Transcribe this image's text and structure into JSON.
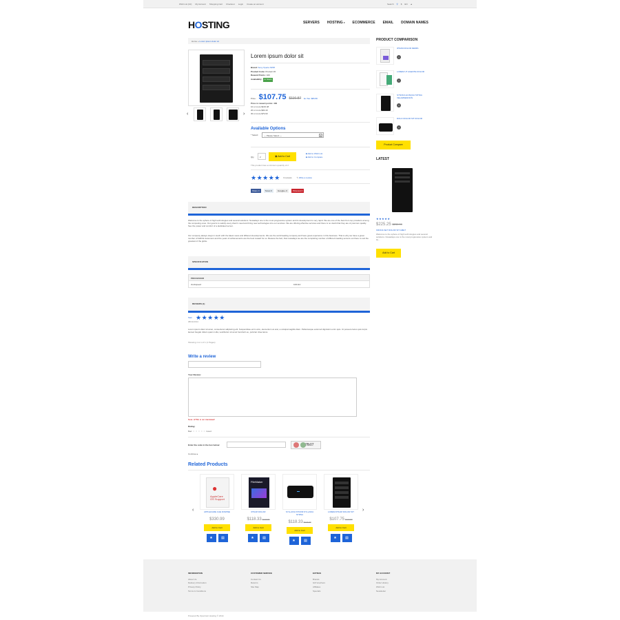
{
  "topbar": {
    "links": [
      "Wish List (10)",
      "My Account",
      "Shopping Cart",
      "Checkout",
      "Login",
      "Create an account"
    ],
    "search_label": "Search",
    "currency": "$",
    "language": "EN"
  },
  "header": {
    "logo_pre": "H",
    "logo_o": "O",
    "logo_post": "STING",
    "nav": [
      "SERVERS",
      "HOSTING",
      "ECOMMERCE",
      "EMAIL",
      "DOMAIN NAMES"
    ]
  },
  "breadcrumb": {
    "home": "Home",
    "sep": "»",
    "current": "Lorem ipsum dolor sit"
  },
  "product": {
    "title": "Lorem ipsum dolor sit",
    "brand_label": "Brand:",
    "brand": "Sony Xperia SP25",
    "code_label": "Product Code:",
    "code": "Product 15",
    "points_label": "Reward Points:",
    "points": "100",
    "avail_label": "Availability:",
    "avail": "In Stock",
    "price_label": "Price:",
    "price": "$107.75",
    "old_price": "$116.87",
    "tax": "Ex Tax: $89.80",
    "reward_note": "Price in reward points: 400",
    "discounts": [
      "10 or more $106.48",
      "20 or more $93.40",
      "30 or more $79.90"
    ],
    "options_head": "Available Options",
    "select_label": "* Select:",
    "select_value": " --- Please Select --- ",
    "qty_label": "Qty",
    "qty_value": "2",
    "add_to_cart": "Add to Cart",
    "wishlist": "Add to Wish List",
    "compare": "Add to Compare",
    "min_qty": "This product has a minimum quantity of 2",
    "reviews_count": "3 reviews",
    "write_review": "Write a review",
    "social": [
      "Share 0",
      "Tweet 0",
      "Google+ 0",
      "Pinterest 0"
    ]
  },
  "tabs": {
    "description": "DESCRIPTION",
    "desc_p1": "Welcome to the sphere of high technologies and several solutions. Nowadays one is the most progressive system and its development is very rapid. We are one of the best from top providers among the competing ones. Our goal is to satisfy every client's need and bring new technologies into our services. We are offering effective services and there is no doubt that they are of premium quality. See the power and comfort of a dedicated server.",
    "desc_p2": "Our company always stays in touch with the latest news and different developments. We are the world leading company and have great experience in this business. That is why we have a great number of faithful customers and the years of achievements are the best reward for us. Beware the fact, that nowadays we are the completing number of different leading servers out there to suit the greatest of the globe.",
    "specification": "SPECIFICATION",
    "spec_group": "PROCESSOR",
    "spec_key": "clockspeed",
    "spec_val": "100mhz",
    "reviews_tab": "REVIEWS (1)",
    "review_author": "Sam",
    "review_date": "08/11/2014",
    "review_text": "Lorem ipsum dolor sit amet, consectetur adipiscing elit. Suspendisse enim arcu, elementum at erat, a volutpat sagittis diam. Pellentesque euismod dignissim enim quis. Ut posuere lacus quis turpis laoreet feugiat. Etiam quam nulla, vestibulum sit amet hendrerit eu, pulvinar vitae lacus.",
    "showing": "Showing 1 to 1 of 1 (1 Pages)"
  },
  "review_form": {
    "head": "Write a review",
    "name_label": "Your Name:",
    "review_label": "Your Review:",
    "note": "Note: HTML is not translated!",
    "rating_label": "Rating:",
    "bad": "Bad",
    "good": "Good",
    "captcha_label": "Enter the code in the box below:",
    "captcha_code": "7fb07",
    "continue": "Continue"
  },
  "related": {
    "head": "Related Products",
    "items": [
      {
        "name": "APPLECARE CAE DOMINE",
        "price": "$330.99",
        "old": "",
        "btn": "Add to Cart"
      },
      {
        "name": "IPSUM DOLOR",
        "price": "$118.33",
        "old": "$129.84",
        "btn": "Add to Cart"
      },
      {
        "name": "SYLLAVIA STNOM SYLLAVIA STRNA",
        "price": "$118.33",
        "old": "$144.90",
        "btn": "Add to Cart"
      },
      {
        "name": "LOREM IPSUM DOLOR SIT",
        "price": "$107.75",
        "old": "$116.87",
        "btn": "Add to Cart"
      }
    ]
  },
  "sidebar": {
    "compare_head": "PRODUCT COMPARISON",
    "compare_items": [
      "IPSUM DOLOR DEMIS",
      "LOREM UT AGENTE DOLOR",
      "SYNOKA HUSQUA TATNIA VELAMSENNON",
      "DOLO DOLOR SIT DOLOR"
    ],
    "compare_btn": "Product Compare",
    "latest_head": "LATEST",
    "latest_name": "KRONA SET DOLOR SIT AMET",
    "latest_price": "$225.25",
    "latest_old": "$239.99",
    "latest_desc": "Welcome to the sphere of high technologies and several solutions. Nowadays one is the most progressive system and its...",
    "latest_btn": "Add to Cart"
  },
  "footer": {
    "cols": [
      {
        "head": "INFORMATION",
        "items": [
          "About Us",
          "Delivery Information",
          "Privacy Policy",
          "Terms & Conditions"
        ]
      },
      {
        "head": "CUSTOMER SERVICE",
        "items": [
          "Contact Us",
          "Returns",
          "Site Map"
        ]
      },
      {
        "head": "EXTRAS",
        "items": [
          "Brands",
          "Gift Vouchers",
          "Affiliates",
          "Specials"
        ]
      },
      {
        "head": "MY ACCOUNT",
        "items": [
          "My Account",
          "Order History",
          "Wish List",
          "Newsletter"
        ]
      }
    ],
    "powered": "Powered By OpenCart Hosting © 2014"
  },
  "colors": {
    "accent": "#1e64d8",
    "button": "#ffe000",
    "stock": "#4aa24a"
  }
}
